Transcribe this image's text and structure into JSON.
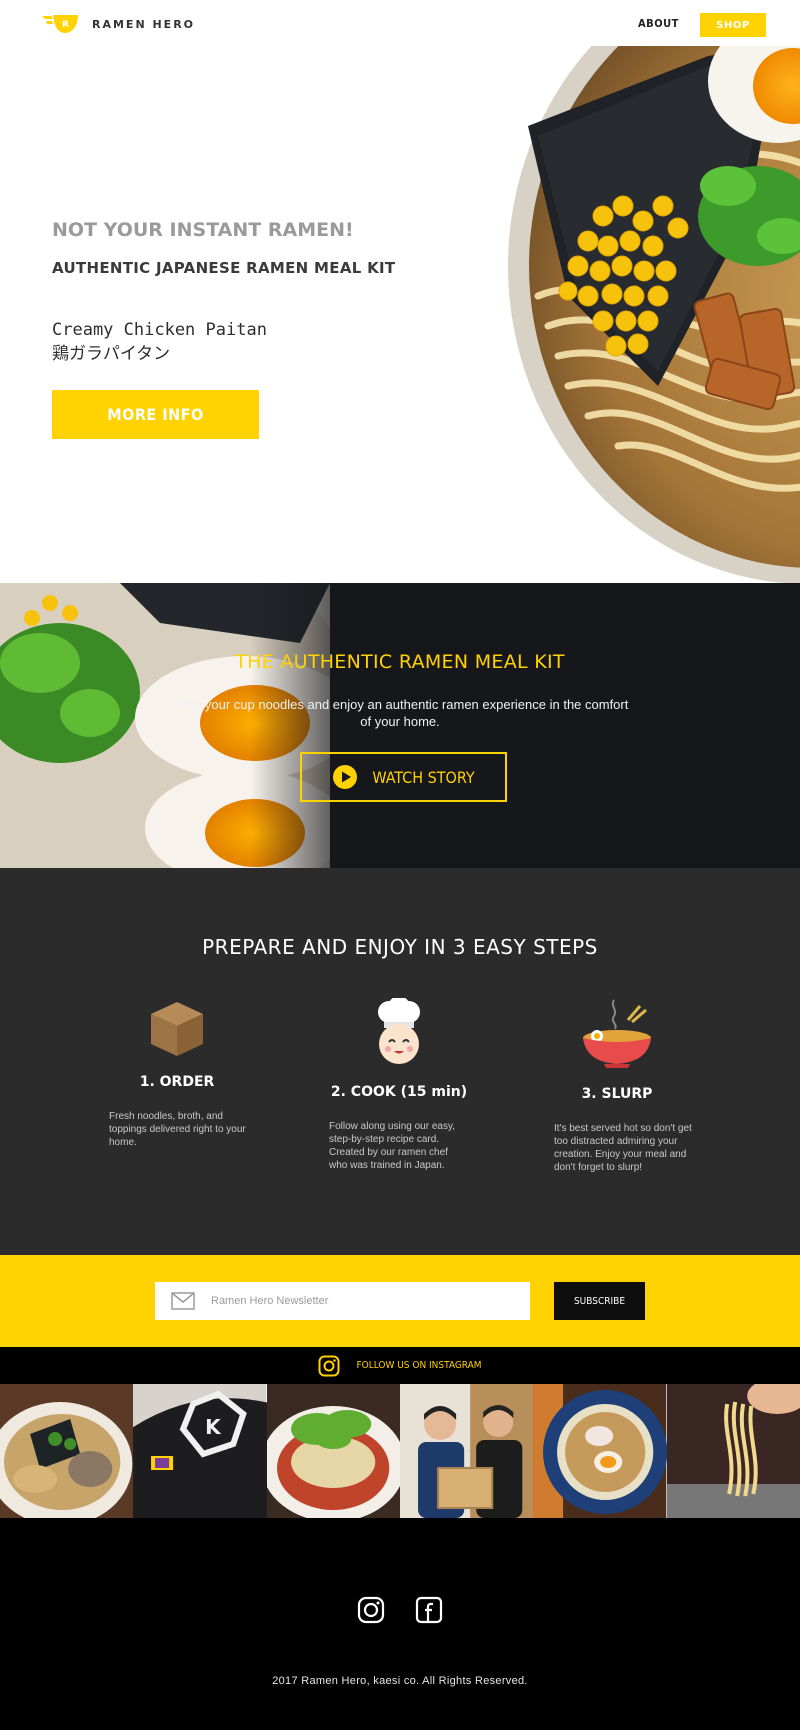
{
  "header": {
    "brand": "RAMEN HERO",
    "nav_about": "ABOUT",
    "nav_shop": "SHOP"
  },
  "hero": {
    "tagline": "NOT YOUR INSTANT RAMEN!",
    "title": "AUTHENTIC JAPANESE RAMEN MEAL KIT",
    "product_en": "Creamy Chicken Paitan",
    "product_jp": "鶏ガラパイタン",
    "button": "MORE INFO"
  },
  "story": {
    "title": "THE AUTHENTIC RAMEN MEAL KIT",
    "text": "Ditch your cup noodles and enjoy an authentic ramen experience in the comfort of your home.",
    "button": "WATCH STORY"
  },
  "steps": {
    "title": "PREPARE AND ENJOY IN 3 EASY STEPS",
    "items": [
      {
        "label": "1. ORDER",
        "text": "Fresh noodles, broth, and toppings delivered right to your home.",
        "icon": "box-icon"
      },
      {
        "label": "2. COOK (15 min)",
        "text": "Follow along using our easy, step-by-step recipe card. Created by our ramen chef who was trained in Japan.",
        "icon": "chef-icon"
      },
      {
        "label": "3. SLURP",
        "text": "It's best served hot so don't get too distracted admiring your creation. Enjoy your meal and don't forget to slurp!",
        "icon": "ramen-bowl-icon"
      }
    ]
  },
  "newsletter": {
    "placeholder": "Ramen Hero Newsletter",
    "button": "SUBSCRIBE"
  },
  "instagram": {
    "label": "FOLLOW US ON INSTAGRAM"
  },
  "footer": {
    "copyright": "2017 Ramen Hero, kaesi co. All Rights Reserved."
  },
  "colors": {
    "accent": "#ffd200",
    "dark": "#2b2b2c",
    "black": "#000000"
  }
}
